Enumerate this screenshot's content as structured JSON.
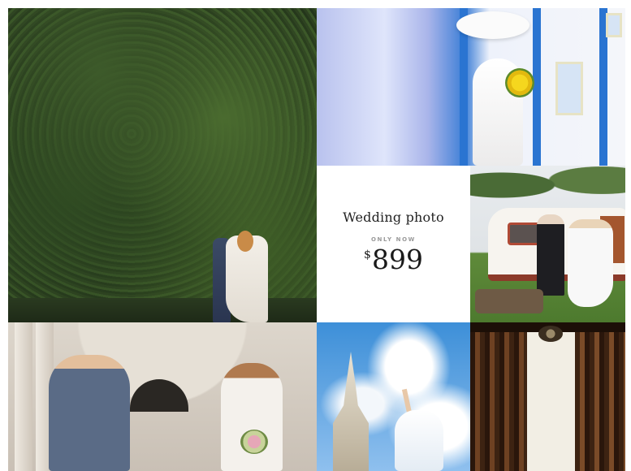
{
  "gallery": {
    "photos": [
      {
        "id_label": "hedge-couple"
      },
      {
        "id_label": "palace-bride"
      },
      {
        "id_label": "caravan-couple"
      },
      {
        "id_label": "arch-couple"
      },
      {
        "id_label": "sky-bride"
      },
      {
        "id_label": "window-curtains"
      }
    ]
  },
  "promo": {
    "title": "Wedding photo",
    "subtitle": "ONLY NOW",
    "currency": "$",
    "amount": "899"
  },
  "colors": {
    "card_background": "#ffffff",
    "text_dark": "#222222",
    "text_muted": "#9a9a9a"
  }
}
